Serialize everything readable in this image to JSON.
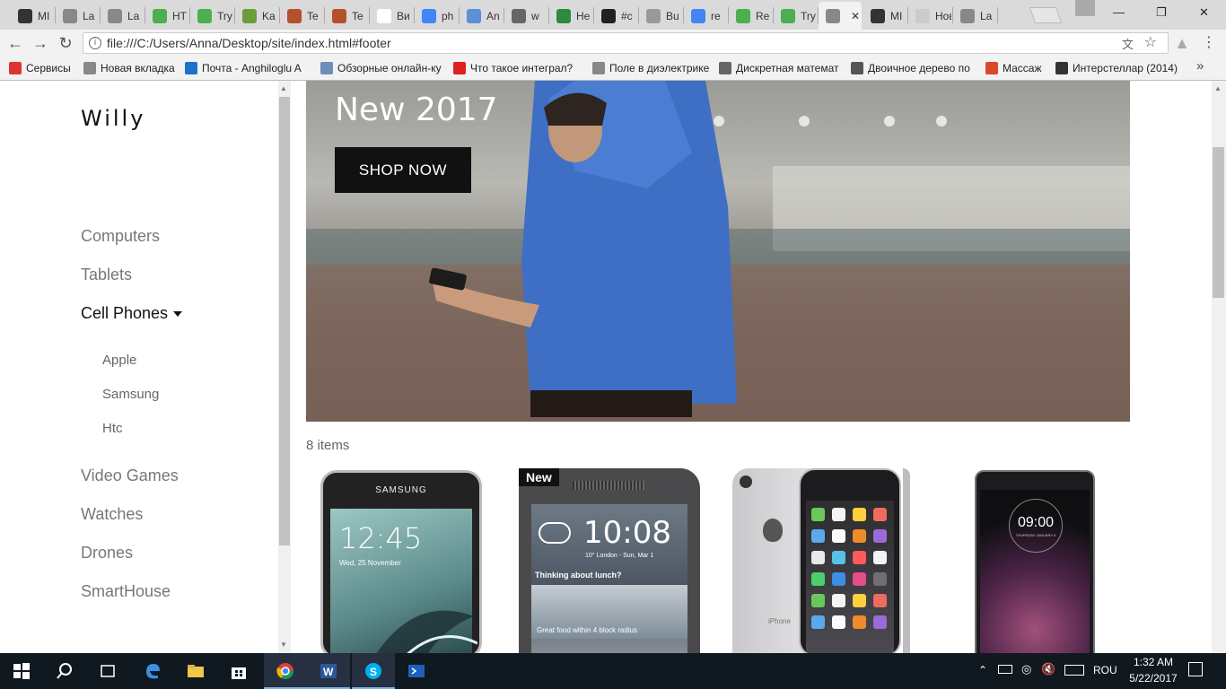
{
  "browser": {
    "tabs": [
      {
        "label": "MI",
        "icon": "github-icon",
        "color": "#333"
      },
      {
        "label": "La",
        "icon": "page-icon",
        "color": "#888"
      },
      {
        "label": "La",
        "icon": "page-icon",
        "color": "#888"
      },
      {
        "label": "HT",
        "icon": "w3-icon",
        "color": "#4caf50"
      },
      {
        "label": "Try",
        "icon": "w3-icon",
        "color": "#4caf50"
      },
      {
        "label": "Ka",
        "icon": "h-icon",
        "color": "#6b9e3a"
      },
      {
        "label": "Te",
        "icon": "grid-icon",
        "color": "#b5502c"
      },
      {
        "label": "Te",
        "icon": "grid-icon",
        "color": "#b5502c"
      },
      {
        "label": "Ви",
        "icon": "wikipedia-icon",
        "color": "#fff"
      },
      {
        "label": "ph",
        "icon": "google-icon",
        "color": "#4285f4"
      },
      {
        "label": "An",
        "icon": "doc-icon",
        "color": "#5b8fd6"
      },
      {
        "label": "w",
        "icon": "link-icon",
        "color": "#666"
      },
      {
        "label": "He",
        "icon": "doc-icon",
        "color": "#2d8a3e"
      },
      {
        "label": "#c",
        "icon": "m-icon",
        "color": "#222"
      },
      {
        "label": "Bu",
        "icon": "pin-icon",
        "color": "#999"
      },
      {
        "label": "re",
        "icon": "google-icon",
        "color": "#4285f4"
      },
      {
        "label": "Re",
        "icon": "w3-icon",
        "color": "#4caf50"
      },
      {
        "label": "Try",
        "icon": "w3-icon",
        "color": "#4caf50"
      },
      {
        "label": "",
        "icon": "page-icon",
        "color": "#888",
        "active": true
      },
      {
        "label": "MI",
        "icon": "github-icon",
        "color": "#333"
      },
      {
        "label": "Новая",
        "icon": "none",
        "color": "#ccc"
      },
      {
        "label": "La",
        "icon": "page-icon",
        "color": "#888"
      }
    ],
    "url": "file:///C:/Users/Anna/Desktop/site/index.html#footer",
    "bookmarks": [
      {
        "label": "Сервисы",
        "icon": "apps-icon"
      },
      {
        "label": "Новая вкладка",
        "icon": "page-icon"
      },
      {
        "label": "Почта - Anghiloglu A",
        "icon": "outlook-icon"
      },
      {
        "label": "Обзорные онлайн-ку",
        "icon": "h-icon"
      },
      {
        "label": "Что такое интеграл?",
        "icon": "flash-icon"
      },
      {
        "label": "Поле в диэлектрике",
        "icon": "page-icon"
      },
      {
        "label": "Дискретная математ",
        "icon": "owl-icon"
      },
      {
        "label": "Двоичное дерево по",
        "icon": "co-icon"
      },
      {
        "label": "Массаж",
        "icon": "massage-icon"
      },
      {
        "label": "Интерстеллар (2014)",
        "icon": "face-icon"
      }
    ]
  },
  "site": {
    "brand": "Willy",
    "nav": {
      "computers": "Computers",
      "tablets": "Tablets",
      "cell_phones": "Cell Phones",
      "sub": {
        "apple": "Apple",
        "samsung": "Samsung",
        "htc": "Htc"
      },
      "video_games": "Video Games",
      "watches": "Watches",
      "drones": "Drones",
      "smarthouse": "SmartHouse"
    },
    "hero": {
      "title": "New 2017",
      "button": "SHOP NOW"
    },
    "items_count": "8 items",
    "products": [
      {
        "brand_label": "SAMSUNG",
        "clock": "12:45",
        "date": "Wed, 25 November",
        "badge": ""
      },
      {
        "brand_label": "",
        "clock": "10:08",
        "date": "10° London - Sun, Mar 1",
        "weather": "Thinking about lunch?",
        "footer_text": "Great food within 4 block radius",
        "badge": "New"
      },
      {
        "brand_label": "",
        "clock": "",
        "date": "",
        "badge": "",
        "back_label": "iPhone"
      },
      {
        "brand_label": "",
        "clock": "09:00",
        "date": "THURSDAY JANUARY 6",
        "badge": ""
      }
    ]
  },
  "taskbar": {
    "lang": "ROU",
    "time": "1:32 AM",
    "date": "5/22/2017"
  },
  "colors": {
    "accent_blue": "#4285f4",
    "taskbar_bg": "#101820"
  }
}
